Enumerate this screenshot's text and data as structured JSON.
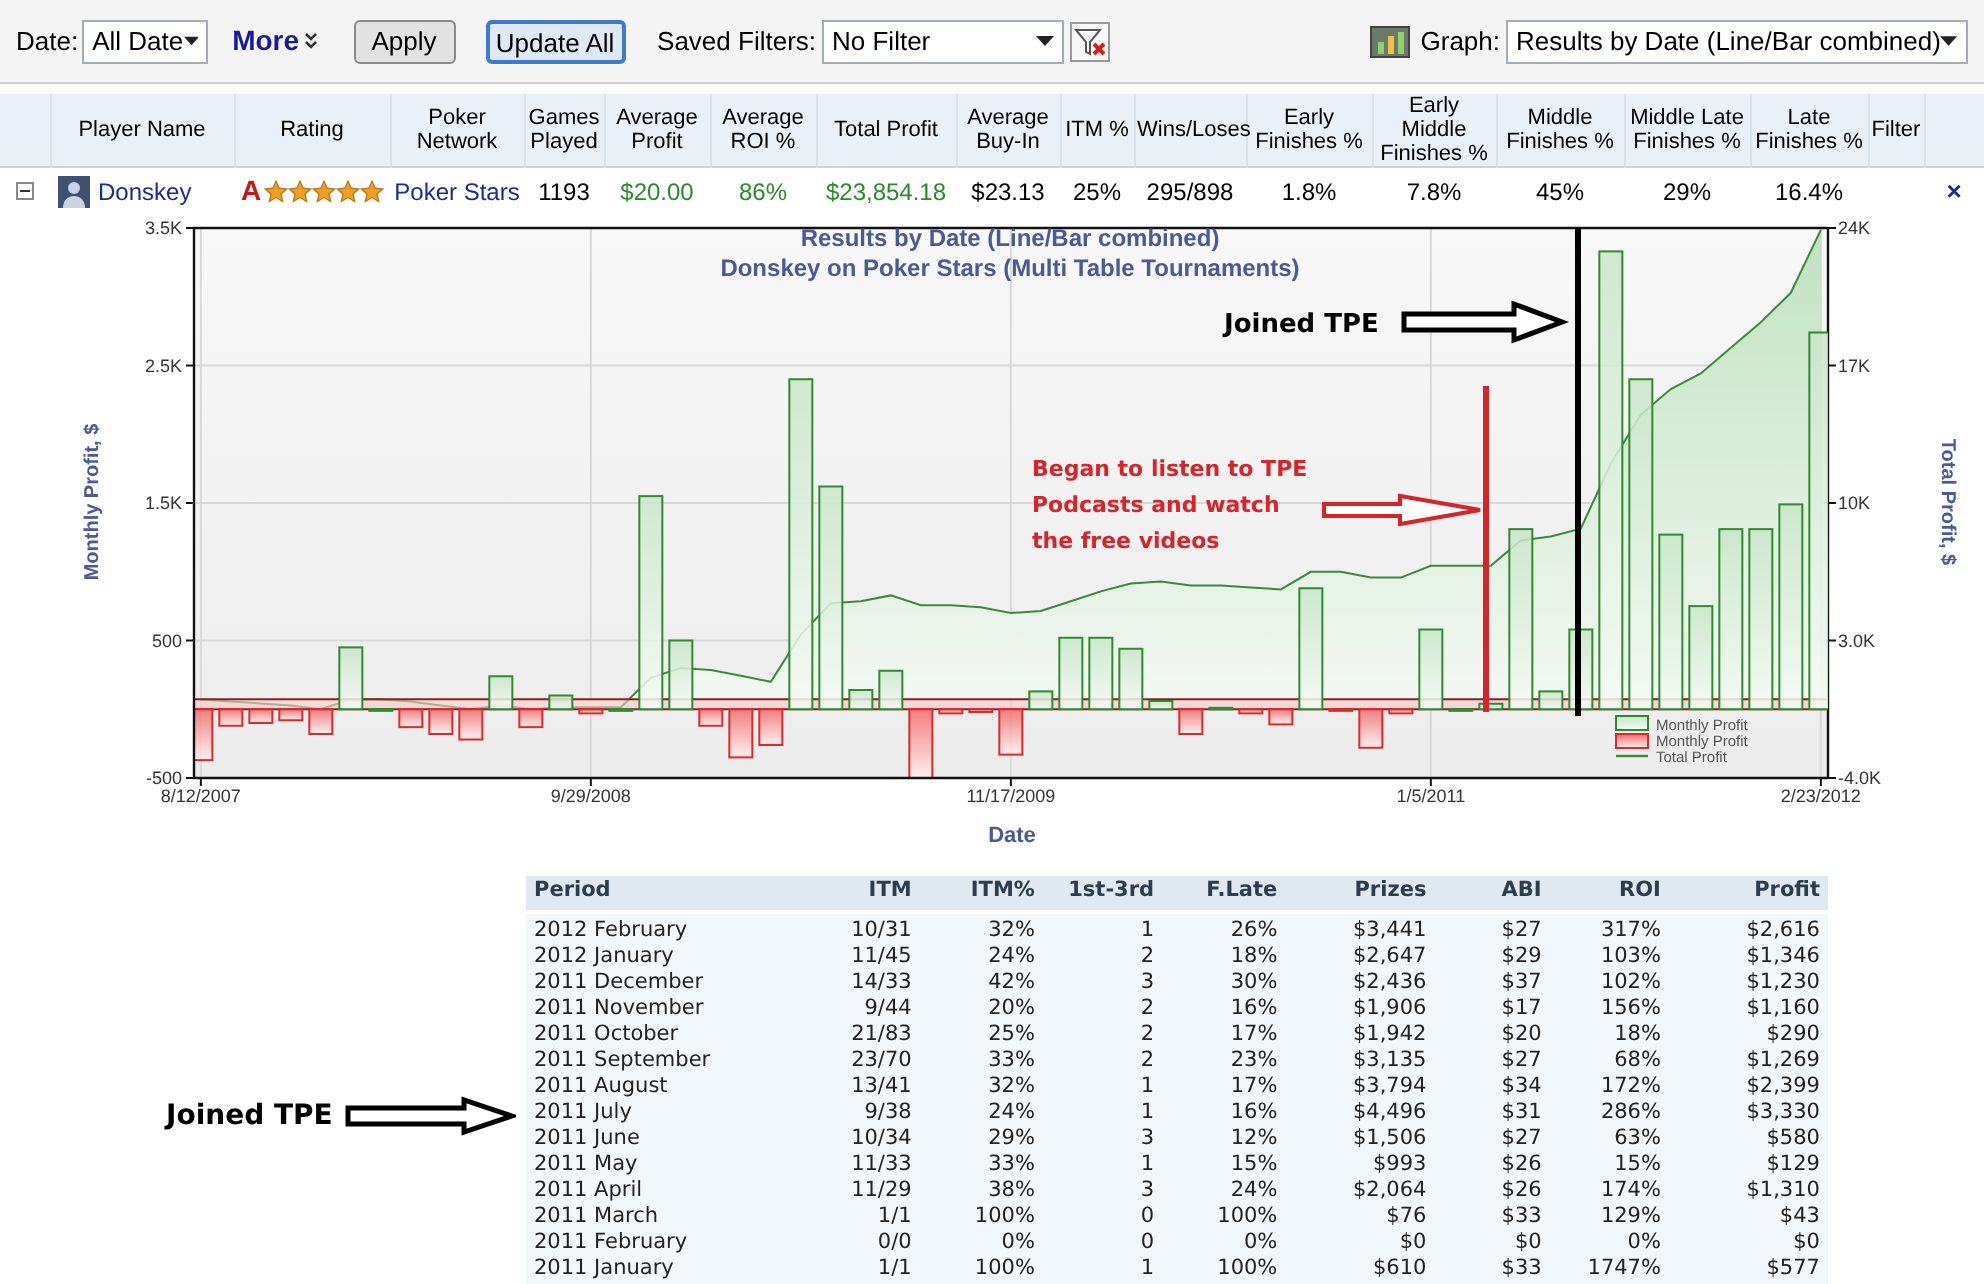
{
  "toolbar": {
    "date_label": "Date:",
    "date_select": "All Date",
    "more_link": "More",
    "apply_button": "Apply",
    "update_button": "Update All",
    "saved_filters_label": "Saved Filters:",
    "saved_filters_select": "No Filter",
    "graph_label": "Graph:",
    "graph_select": "Results by Date (Line/Bar combined)"
  },
  "player_table": {
    "columns": [
      "Player Name",
      "Rating",
      "Poker Network",
      "Games Played",
      "Average Profit",
      "Average ROI %",
      "Total Profit",
      "Average Buy-In",
      "ITM %",
      "Wins/Loses",
      "Early Finishes %",
      "Early Middle Finishes %",
      "Middle Finishes %",
      "Middle Late Finishes %",
      "Late Finishes %",
      "Filter"
    ],
    "rows": [
      {
        "expanded": true,
        "player": "Donskey",
        "rating": {
          "grade": "A",
          "stars": 5
        },
        "network": "Poker Stars",
        "stats": [
          {
            "text": "1193",
            "positive": false
          },
          {
            "text": "$20.00",
            "positive": true
          },
          {
            "text": "86%",
            "positive": true
          },
          {
            "text": "$23,854.18",
            "positive": true
          },
          {
            "text": "$23.13",
            "positive": false
          },
          {
            "text": "25%",
            "positive": false
          },
          {
            "text": "295/898",
            "positive": false
          },
          {
            "text": "1.8%",
            "positive": false
          },
          {
            "text": "7.8%",
            "positive": false
          },
          {
            "text": "45%",
            "positive": false
          },
          {
            "text": "29%",
            "positive": false
          },
          {
            "text": "16.4%",
            "positive": false
          }
        ],
        "remove": "×"
      }
    ]
  },
  "chart": {
    "subtitle": "Donskey on Poker Stars (Multi Table Tournaments)",
    "notes": [
      {
        "kind": "headline",
        "lines": [
          "Joined TPE"
        ],
        "color": "#000000"
      },
      {
        "kind": "boxed",
        "lines": [
          "Began to listen to TPE",
          "Podcasts and watch",
          "the free videos"
        ],
        "color": "#d9232a"
      }
    ],
    "chart_data": {
      "type": "bar",
      "title": "Results by Date (Line/Bar combined)",
      "xlabel": "Date",
      "ylabel": "Monthly Profit, $",
      "ylim": [
        -500,
        3500
      ],
      "yticks": [
        {
          "value": 3500,
          "label": "3.5K"
        },
        {
          "value": 2500,
          "label": "2.5K"
        },
        {
          "value": 1500,
          "label": "1.5K"
        },
        {
          "value": 500,
          "label": "500"
        },
        {
          "value": -500,
          "label": "-500"
        }
      ],
      "categories": [
        "8/12/2007",
        null,
        null,
        null,
        null,
        null,
        null,
        null,
        null,
        null,
        null,
        null,
        null,
        "9/29/2008",
        null,
        null,
        null,
        null,
        null,
        null,
        null,
        null,
        null,
        null,
        null,
        null,
        null,
        "11/17/2009",
        null,
        null,
        null,
        null,
        null,
        null,
        null,
        null,
        null,
        null,
        null,
        null,
        null,
        "1/5/2011",
        null,
        null,
        null,
        null,
        null,
        null,
        null,
        null,
        null,
        null,
        null,
        null,
        "2/23/2012"
      ],
      "series": [
        {
          "name": "Monthly Profit",
          "color": "#2e8b2e",
          "values": [
            null,
            null,
            null,
            null,
            null,
            450,
            0,
            null,
            null,
            null,
            240,
            null,
            100,
            null,
            0,
            1550,
            500,
            null,
            null,
            null,
            2400,
            1620,
            140,
            280,
            null,
            null,
            null,
            null,
            130,
            520,
            520,
            440,
            60,
            null,
            10,
            null,
            null,
            880,
            null,
            null,
            null,
            580,
            0,
            40,
            1310,
            130,
            580,
            3330,
            2400,
            1270,
            750,
            1310,
            1310,
            1490,
            2740
          ]
        },
        {
          "name": "Monthly Profit",
          "color": "#e02828",
          "values": [
            -370,
            -120,
            -100,
            -80,
            -180,
            null,
            null,
            -130,
            -180,
            -220,
            null,
            -130,
            null,
            -30,
            null,
            null,
            null,
            -120,
            -350,
            -260,
            null,
            null,
            null,
            null,
            -500,
            -30,
            -20,
            -330,
            null,
            null,
            null,
            null,
            null,
            -180,
            null,
            -30,
            -110,
            null,
            -10,
            -280,
            -30,
            null,
            null,
            null,
            null,
            null,
            null,
            null,
            null,
            null,
            null,
            null,
            null,
            null,
            null
          ]
        }
      ]
    }
  },
  "total_profit_chart": {
    "chart_data": {
      "type": "area",
      "grid": true,
      "ylabel": "Total Profit, $",
      "ylim": [
        -4000,
        24000
      ],
      "yticks": [
        {
          "value": 24000,
          "label": "24K"
        },
        {
          "value": 17000,
          "label": "17K"
        },
        {
          "value": 10000,
          "label": "10K"
        },
        {
          "value": 3000,
          "label": "3.0K"
        },
        {
          "value": -4000,
          "label": "-4.0K"
        }
      ],
      "categories": [
        null,
        null,
        null,
        null,
        null,
        null,
        null,
        null,
        null,
        null,
        null,
        null,
        null,
        null,
        null,
        null,
        null,
        null,
        null,
        null,
        null,
        null,
        null,
        null,
        null,
        null,
        null,
        null,
        null,
        null,
        null,
        null,
        null,
        null,
        null,
        null,
        null,
        null,
        null,
        null,
        null,
        null,
        null,
        null,
        null,
        null,
        null,
        null,
        null,
        null,
        null,
        null,
        null,
        null,
        null
      ],
      "series": [
        {
          "name": "Total Profit",
          "color": "#3a8a3a",
          "values": [
            0,
            -100,
            -200,
            -300,
            -500,
            0,
            0,
            -100,
            -300,
            -500,
            -300,
            -500,
            -400,
            -400,
            -400,
            1100,
            1600,
            1500,
            1200,
            900,
            3300,
            4900,
            5000,
            5300,
            4800,
            4800,
            4700,
            4400,
            4500,
            5000,
            5500,
            5900,
            6000,
            5800,
            5800,
            5700,
            5600,
            6500,
            6500,
            6200,
            6200,
            6800,
            6800,
            6800,
            8100,
            8300,
            8700,
            12000,
            14500,
            15800,
            16600,
            17900,
            19200,
            20700,
            23900
          ]
        }
      ]
    }
  },
  "side_note": "Joined TPE",
  "period_table": {
    "columns": [
      "Period",
      "ITM",
      "ITM%",
      "1st-3rd",
      "F.Late",
      "Prizes",
      "ABI",
      "ROI",
      "Profit"
    ],
    "rows": [
      [
        "2012 February",
        "10/31",
        "32%",
        "1",
        "26%",
        "$3,441",
        "$27",
        "317%",
        "$2,616"
      ],
      [
        "2012 January",
        "11/45",
        "24%",
        "2",
        "18%",
        "$2,647",
        "$29",
        "103%",
        "$1,346"
      ],
      [
        "2011 December",
        "14/33",
        "42%",
        "3",
        "30%",
        "$2,436",
        "$37",
        "102%",
        "$1,230"
      ],
      [
        "2011 November",
        "9/44",
        "20%",
        "2",
        "16%",
        "$1,906",
        "$17",
        "156%",
        "$1,160"
      ],
      [
        "2011 October",
        "21/83",
        "25%",
        "2",
        "17%",
        "$1,942",
        "$20",
        "18%",
        "$290"
      ],
      [
        "2011 September",
        "23/70",
        "33%",
        "2",
        "23%",
        "$3,135",
        "$27",
        "68%",
        "$1,269"
      ],
      [
        "2011 August",
        "13/41",
        "32%",
        "1",
        "17%",
        "$3,794",
        "$34",
        "172%",
        "$2,399"
      ],
      [
        "2011 July",
        "9/38",
        "24%",
        "1",
        "16%",
        "$4,496",
        "$31",
        "286%",
        "$3,330"
      ],
      [
        "2011 June",
        "10/34",
        "29%",
        "3",
        "12%",
        "$1,506",
        "$27",
        "63%",
        "$580"
      ],
      [
        "2011 May",
        "11/33",
        "33%",
        "1",
        "15%",
        "$993",
        "$26",
        "15%",
        "$129"
      ],
      [
        "2011 April",
        "11/29",
        "38%",
        "3",
        "24%",
        "$2,064",
        "$26",
        "174%",
        "$1,310"
      ],
      [
        "2011 March",
        "1/1",
        "100%",
        "0",
        "100%",
        "$76",
        "$33",
        "129%",
        "$43"
      ],
      [
        "2011 February",
        "0/0",
        "0%",
        "0",
        "0%",
        "$0",
        "$0",
        "0%",
        "$0"
      ],
      [
        "2011 January",
        "1/1",
        "100%",
        "1",
        "100%",
        "$610",
        "$33",
        "1747%",
        "$577"
      ]
    ]
  }
}
